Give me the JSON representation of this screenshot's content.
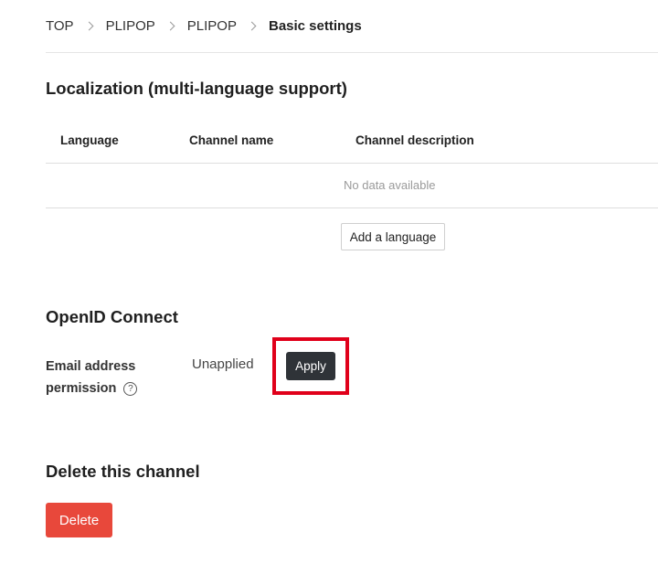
{
  "breadcrumb": {
    "items": [
      "TOP",
      "PLIPOP",
      "PLIPOP"
    ],
    "current": "Basic settings"
  },
  "localization": {
    "title": "Localization (multi-language support)",
    "columns": [
      "Language",
      "Channel name",
      "Channel description"
    ],
    "empty_text": "No data available",
    "add_button": "Add a language"
  },
  "openid": {
    "title": "OpenID Connect",
    "email_label_line1": "Email address",
    "email_label_line2": "permission",
    "status": "Unapplied",
    "apply_button": "Apply",
    "highlight_color": "#e0001a"
  },
  "delete_section": {
    "title": "Delete this channel",
    "delete_button": "Delete",
    "button_color": "#e8483b"
  }
}
